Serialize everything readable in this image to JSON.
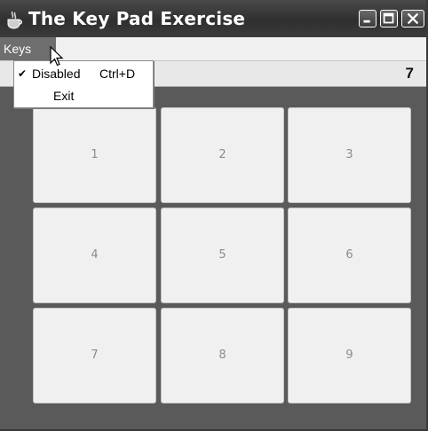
{
  "window": {
    "title": "The Key Pad Exercise",
    "icon": "java-coffee-cup-icon",
    "controls": {
      "minimize": "minimize-icon",
      "maximize": "maximize-icon",
      "close": "close-icon"
    }
  },
  "menubar": {
    "keys_label": "Keys"
  },
  "menu_keys_dropdown": {
    "items": [
      {
        "label": "Disabled",
        "shortcut": "Ctrl+D",
        "checked_glyph": "✔"
      },
      {
        "label": "Exit"
      }
    ]
  },
  "display": {
    "value": "7"
  },
  "keypad": {
    "keys": [
      "1",
      "2",
      "3",
      "4",
      "5",
      "6",
      "7",
      "8",
      "9"
    ]
  },
  "colors": {
    "window_background": "#5a5a5a",
    "titlebar": "#333333",
    "key_face": "#f0f0f0",
    "key_text": "#8c8c8c",
    "menu_highlight": "#6e6e6e"
  }
}
